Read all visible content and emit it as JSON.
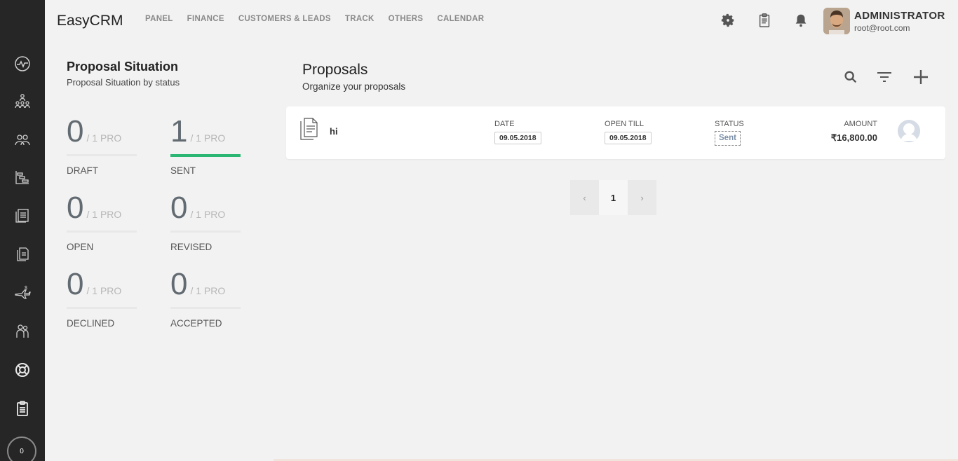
{
  "app": {
    "brand": "EasyCRM"
  },
  "nav": {
    "items": [
      "PANEL",
      "FINANCE",
      "CUSTOMERS & LEADS",
      "TRACK",
      "OTHERS",
      "CALENDAR"
    ]
  },
  "user": {
    "name": "ADMINISTRATOR",
    "email": "root@root.com"
  },
  "sidebar": {
    "icons": [
      "pulse-icon",
      "org-chart-icon",
      "users-icon",
      "gantt-icon",
      "documents-icon",
      "copy-icon",
      "plane-money-icon",
      "people-icon",
      "lifebuoy-icon",
      "clipboard-icon"
    ],
    "counter": "0"
  },
  "stats": {
    "title": "Proposal Situation",
    "subtitle": "Proposal Situation by status",
    "items": [
      {
        "label": "DRAFT",
        "count": "0",
        "of": "/ 1 PRO"
      },
      {
        "label": "SENT",
        "count": "1",
        "of": "/ 1 PRO",
        "active": true
      },
      {
        "label": "OPEN",
        "count": "0",
        "of": "/ 1 PRO"
      },
      {
        "label": "REVISED",
        "count": "0",
        "of": "/ 1 PRO"
      },
      {
        "label": "DECLINED",
        "count": "0",
        "of": "/ 1 PRO"
      },
      {
        "label": "ACCEPTED",
        "count": "0",
        "of": "/ 1 PRO"
      }
    ]
  },
  "proposals": {
    "title": "Proposals",
    "subtitle": "Organize your proposals",
    "columns": {
      "date": "DATE",
      "open_till": "OPEN TILL",
      "status": "STATUS",
      "amount": "AMOUNT"
    },
    "rows": [
      {
        "name": "hi",
        "date": "09.05.2018",
        "open_till": "09.05.2018",
        "status": "Sent",
        "amount": "₹16,800.00"
      }
    ]
  },
  "pagination": {
    "prev": "‹",
    "current": "1",
    "next": "›"
  },
  "colors": {
    "sidebar": "#262626",
    "accent_green": "#2bb673",
    "background": "#f2f2f2"
  }
}
